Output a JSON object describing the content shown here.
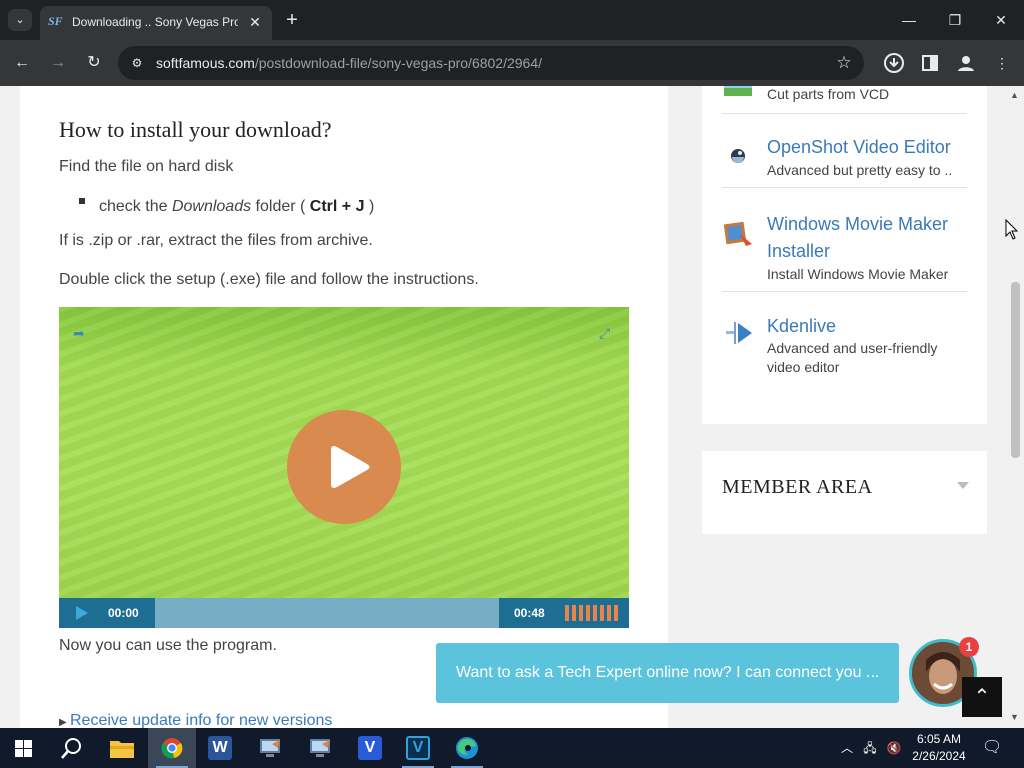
{
  "browser": {
    "tab_title": "Downloading .. Sony Vegas Pro",
    "tab_favicon": "SF",
    "url_host": "softfamous.com",
    "url_path": "/postdownload-file/sony-vegas-pro/6802/2964/",
    "icons": [
      "tab-search-icon",
      "close-icon",
      "plus-icon",
      "minimize-icon",
      "restore-icon",
      "window-close-icon",
      "back-icon",
      "forward-icon",
      "reload-icon",
      "site-info-icon",
      "star-icon",
      "download-icon",
      "sidebar-icon",
      "profile-icon",
      "menu-icon"
    ]
  },
  "install": {
    "heading": "How to install your download?",
    "step1": "Find the file on hard disk",
    "bullet_pre": "check the",
    "bullet_em": "Downloads",
    "bullet_mid": "folder (",
    "bullet_key": "Ctrl + J",
    "bullet_post": ")",
    "step2": "If is .zip or .rar, extract the files from archive.",
    "step3": "Double click the setup (.exe) file and follow the instructions.",
    "done": "Now you can use the program.",
    "update_link": "Receive update info for new versions"
  },
  "video": {
    "current_time": "00:00",
    "duration": "00:48",
    "progress": 0,
    "colors": {
      "bg": "#9ed84d",
      "play": "#d98a4e",
      "controls": "#1e6e94"
    }
  },
  "sidebar": {
    "items": [
      {
        "title": "",
        "desc": "Cut parts from VCD",
        "icon": "vcd-cutter-icon"
      },
      {
        "title": "OpenShot Video Editor",
        "desc": "Advanced but pretty easy to ..",
        "icon": "openshot-icon"
      },
      {
        "title": "Windows Movie Maker Installer",
        "desc": "Install Windows Movie Maker",
        "icon": "movie-maker-icon"
      },
      {
        "title": "Kdenlive",
        "desc": "Advanced and user-friendly video editor",
        "icon": "kdenlive-icon"
      }
    ],
    "member_area": "MEMBER AREA"
  },
  "chat": {
    "text": "Want to ask a Tech Expert online now? I can connect you ...",
    "badge": "1"
  },
  "taskbar": {
    "apps": [
      "start-icon",
      "search-icon",
      "file-explorer-icon",
      "chrome-icon",
      "word-icon",
      "app-icon",
      "app-icon",
      "vegas-icon",
      "vegas-pro-icon",
      "edge-icon"
    ],
    "word_letter": "W",
    "v1_letter": "V",
    "v2_letter": "V",
    "time": "6:05 AM",
    "date": "2/26/2024"
  },
  "colors": {
    "link": "#3a7ab8",
    "chat": "#5bc4dc"
  }
}
